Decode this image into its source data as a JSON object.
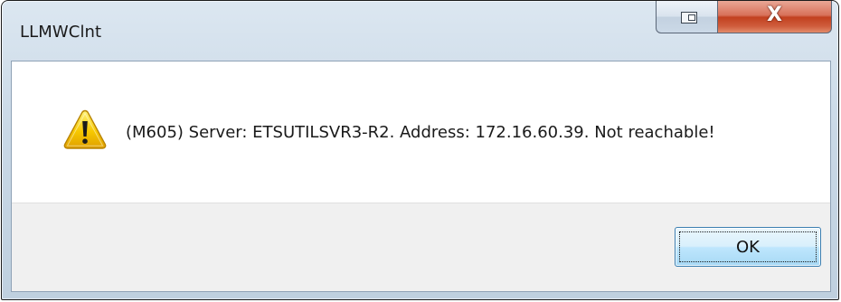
{
  "window": {
    "title": "LLMWClnt"
  },
  "title_bar_buttons": [
    {
      "name": "restore",
      "icon": "restore-window-icon"
    },
    {
      "name": "close",
      "icon": "close-icon",
      "glyph": "X"
    }
  ],
  "dialog": {
    "icon": "warning-icon",
    "message": "(M605) Server: ETSUTILSVR3-R2. Address: 172.16.60.39. Not reachable!"
  },
  "buttons": {
    "ok_label": "OK"
  },
  "colors": {
    "title_bar": "#c9d8e6",
    "close_button": "#c2401f",
    "button_strip": "#f0f0f0",
    "warning_yellow": "#f5c400"
  }
}
